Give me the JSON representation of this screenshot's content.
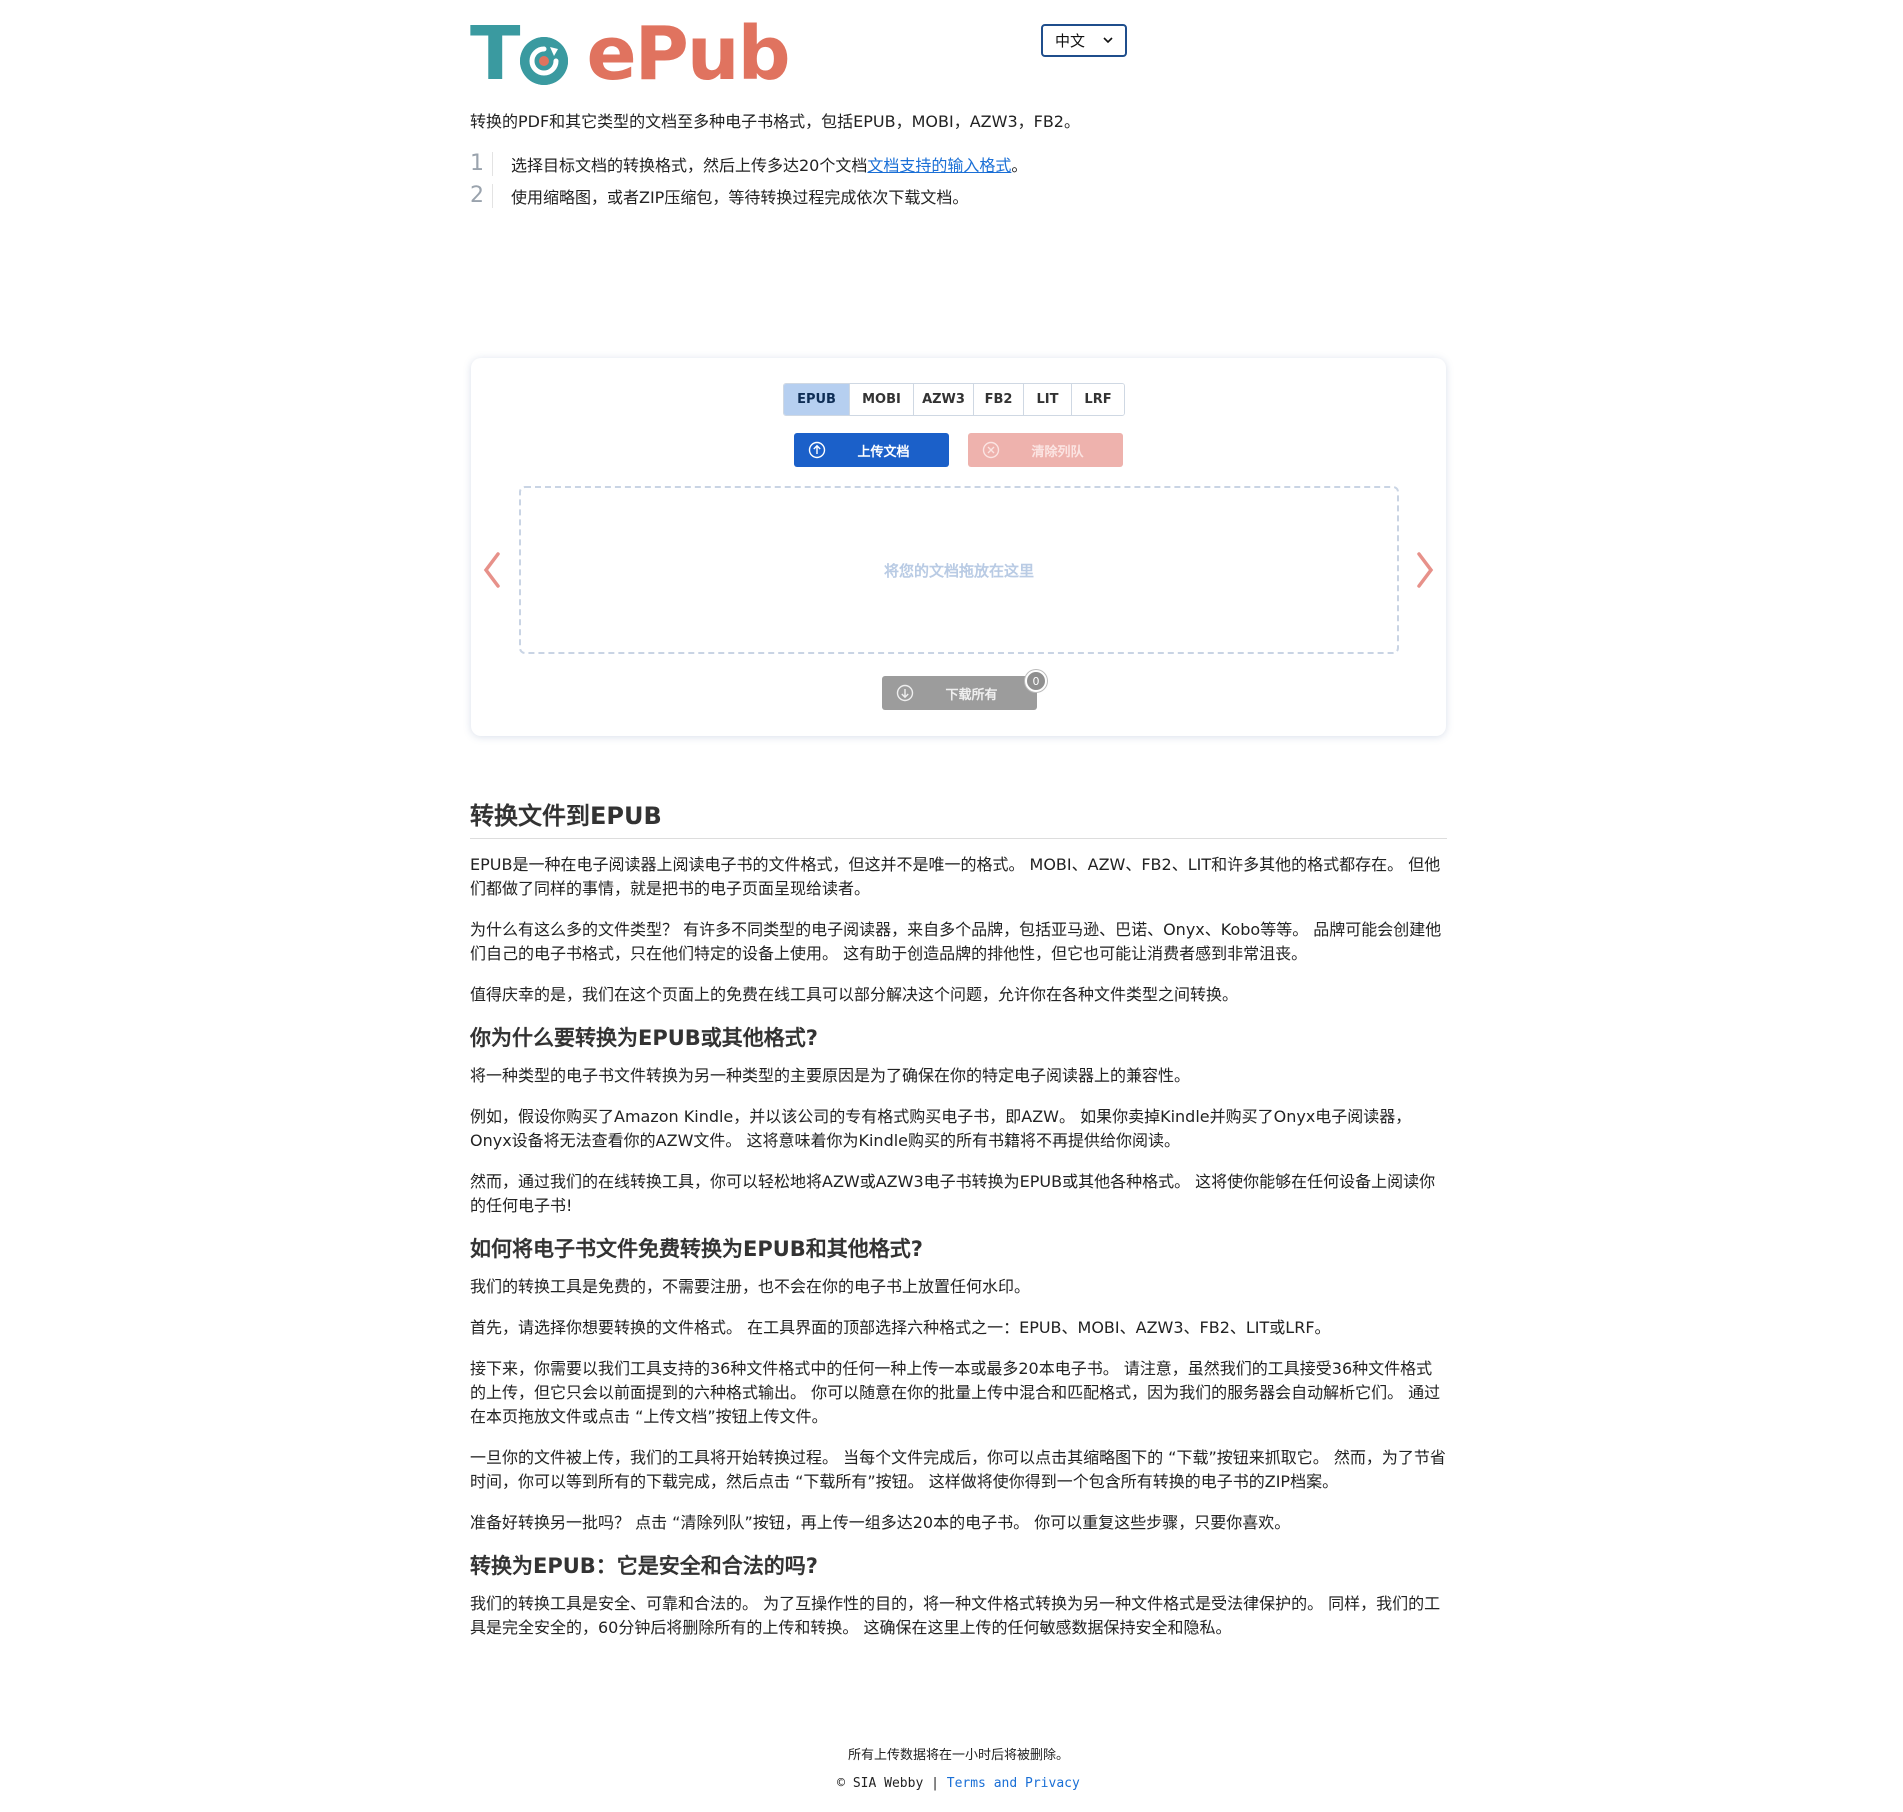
{
  "header": {
    "logo_text_prefix": "T",
    "logo_text_brand": "ePub",
    "language_selector": {
      "selected": "中文"
    }
  },
  "intro": "转换的PDF和其它类型的文档至多种电子书格式，包括EPUB，MOBI，AZW3，FB2。",
  "steps": [
    {
      "num": "1",
      "text": "选择目标文档的转换格式，然后上传多达20个文档",
      "link": "文档支持的输入格式",
      "after": "。"
    },
    {
      "num": "2",
      "text": "使用缩略图，或者ZIP压缩包，等待转换过程完成依次下载文档。"
    }
  ],
  "tool": {
    "format_tabs": [
      "EPUB",
      "MOBI",
      "AZW3",
      "FB2",
      "LIT",
      "LRF"
    ],
    "active_format": "EPUB",
    "upload_label": "上传文档",
    "clear_label": "清除列队",
    "drop_text": "将您的文档拖放在这里",
    "download_all_label": "下载所有",
    "download_count": "0"
  },
  "article": {
    "h1": "转换文件到EPUB",
    "p1": "EPUB是一种在电子阅读器上阅读电子书的文件格式，但这并不是唯一的格式。 MOBI、AZW、FB2、LIT和许多其他的格式都存在。 但他们都做了同样的事情，就是把书的电子页面呈现给读者。",
    "p2": "为什么有这么多的文件类型？ 有许多不同类型的电子阅读器，来自多个品牌，包括亚马逊、巴诺、Onyx、Kobo等等。 品牌可能会创建他们自己的电子书格式，只在他们特定的设备上使用。 这有助于创造品牌的排他性，但它也可能让消费者感到非常沮丧。",
    "p3": "值得庆幸的是，我们在这个页面上的免费在线工具可以部分解决这个问题，允许你在各种文件类型之间转换。",
    "h2": "你为什么要转换为EPUB或其他格式?",
    "p4": "将一种类型的电子书文件转换为另一种类型的主要原因是为了确保在你的特定电子阅读器上的兼容性。",
    "p5": "例如，假设你购买了Amazon Kindle，并以该公司的专有格式购买电子书，即AZW。 如果你卖掉Kindle并购买了Onyx电子阅读器，Onyx设备将无法查看你的AZW文件。 这将意味着你为Kindle购买的所有书籍将不再提供给你阅读。",
    "p6": "然而，通过我们的在线转换工具，你可以轻松地将AZW或AZW3电子书转换为EPUB或其他各种格式。 这将使你能够在任何设备上阅读你的任何电子书!",
    "h3": "如何将电子书文件免费转换为EPUB和其他格式?",
    "p7": "我们的转换工具是免费的，不需要注册，也不会在你的电子书上放置任何水印。",
    "p8": "首先，请选择你想要转换的文件格式。 在工具界面的顶部选择六种格式之一：EPUB、MOBI、AZW3、FB2、LIT或LRF。",
    "p9": "接下来，你需要以我们工具支持的36种文件格式中的任何一种上传一本或最多20本电子书。 请注意，虽然我们的工具接受36种文件格式的上传，但它只会以前面提到的六种格式输出。 你可以随意在你的批量上传中混合和匹配格式，因为我们的服务器会自动解析它们。 通过在本页拖放文件或点击 “上传文档”按钮上传文件。",
    "p10": "一旦你的文件被上传，我们的工具将开始转换过程。 当每个文件完成后，你可以点击其缩略图下的 “下载”按钮来抓取它。 然而，为了节省时间，你可以等到所有的下载完成，然后点击 “下载所有”按钮。 这样做将使你得到一个包含所有转换的电子书的ZIP档案。",
    "p11": "准备好转换另一批吗？ 点击 “清除列队”按钮，再上传一组多达20本的电子书。 你可以重复这些步骤，只要你喜欢。",
    "h4": "转换为EPUB：它是安全和合法的吗?",
    "p12": "我们的转换工具是安全、可靠和合法的。 为了互操作性的目的，将一种文件格式转换为另一种文件格式是受法律保护的。 同样，我们的工具是完全安全的，60分钟后将删除所有的上传和转换。 这确保在这里上传的任何敏感数据保持安全和隐私。"
  },
  "footer": {
    "notice": "所有上传数据将在一小时后将被删除。",
    "copyright": "© SIA Webby | ",
    "terms_link": "Terms and Privacy"
  },
  "colors": {
    "brand_teal": "#3a9aa0",
    "brand_coral": "#e0735f",
    "upload_blue": "#1b60c9",
    "clear_pink": "#eeb2ad",
    "download_gray": "#9c9c9c",
    "link_blue": "#1a6fd6"
  },
  "icons": {
    "upload": "arrow-up-circle-icon",
    "clear": "x-circle-icon",
    "download": "arrow-down-circle-icon",
    "prev": "chevron-left-icon",
    "next": "chevron-right-icon",
    "lang": "chevron-down-icon"
  }
}
